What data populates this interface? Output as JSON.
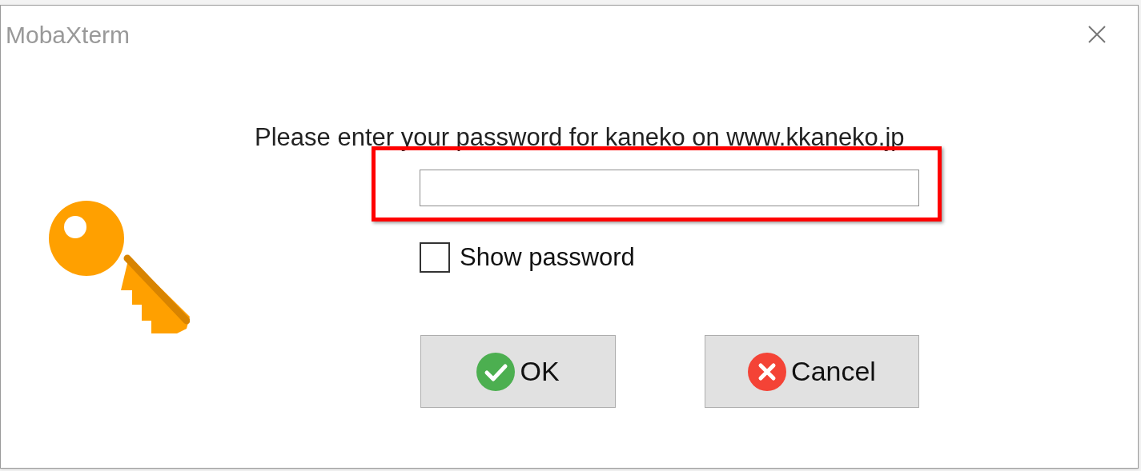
{
  "window": {
    "title": "MobaXterm"
  },
  "prompt": "Please enter your password for kaneko on www.kkaneko.jp",
  "password_field": {
    "highlighted": true
  },
  "show_password": {
    "label": "Show password",
    "checked": false
  },
  "buttons": [
    {
      "kind": "ok",
      "label": "OK"
    },
    {
      "kind": "cancel",
      "label": "Cancel"
    }
  ]
}
